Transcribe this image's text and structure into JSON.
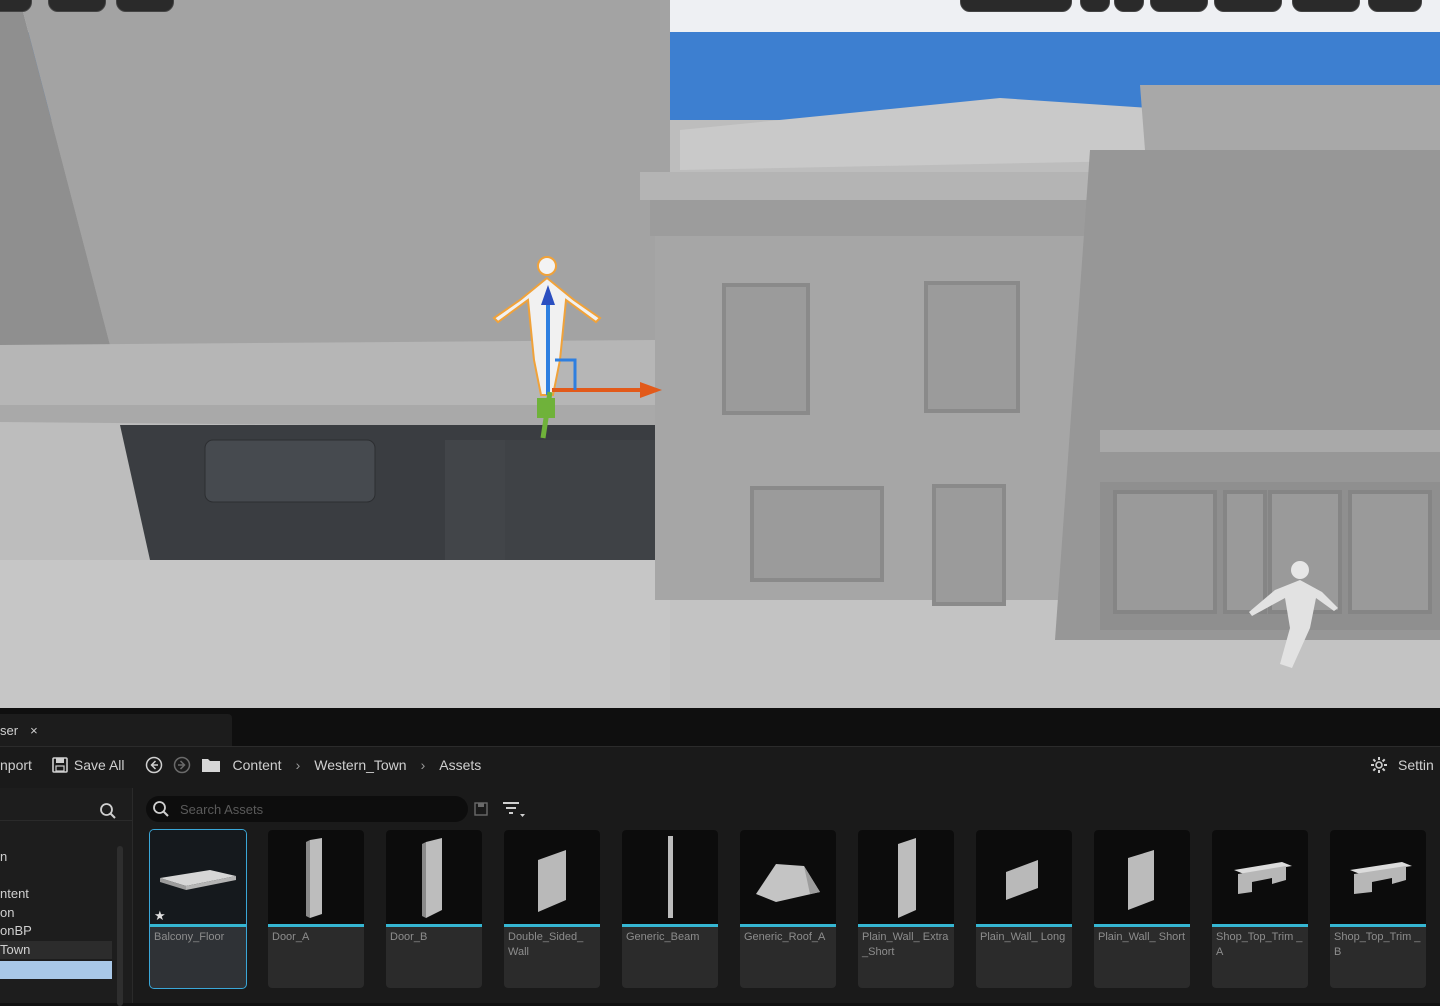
{
  "content_browser": {
    "tab_label": "ser",
    "tab_close": "×",
    "toolbar": {
      "import_label": "nport",
      "save_all_label": "Save All",
      "breadcrumb": [
        "Content",
        "Western_Town",
        "Assets"
      ],
      "settings_label": "Settin"
    },
    "tree": {
      "items": [
        "n",
        "ntent",
        "on",
        "onBP",
        "Town",
        ""
      ]
    },
    "search": {
      "placeholder": "Search Assets"
    },
    "assets": [
      {
        "name": "Balcony_Floor",
        "favorite": true,
        "selected": true,
        "icon": "slab-mesh-icon"
      },
      {
        "name": "Door_A",
        "icon": "door-mesh-icon"
      },
      {
        "name": "Door_B",
        "icon": "door-mesh-icon"
      },
      {
        "name": "Double_Sided_ Wall",
        "icon": "wall-mesh-icon"
      },
      {
        "name": "Generic_Beam",
        "icon": "beam-mesh-icon"
      },
      {
        "name": "Generic_Roof_A",
        "icon": "roof-mesh-icon"
      },
      {
        "name": "Plain_Wall_ Extra_Short",
        "icon": "wall-mesh-icon"
      },
      {
        "name": "Plain_Wall_ Long",
        "icon": "wall-mesh-icon"
      },
      {
        "name": "Plain_Wall_ Short",
        "icon": "wall-mesh-icon"
      },
      {
        "name": "Shop_Top_Trim _A",
        "icon": "trim-mesh-icon"
      },
      {
        "name": "Shop_Top_Trim _B",
        "icon": "trim-mesh-icon"
      }
    ],
    "accent_color": "#35b6d2"
  }
}
